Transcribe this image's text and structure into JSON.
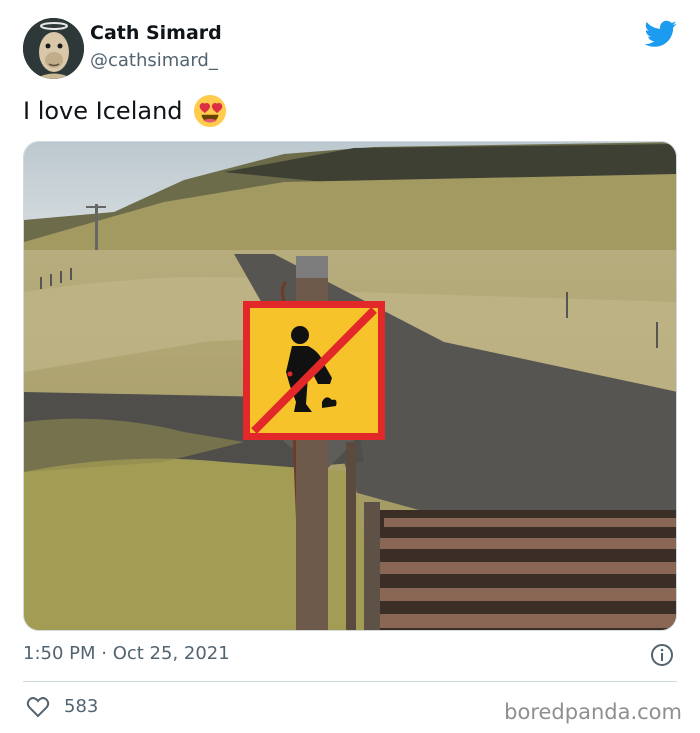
{
  "author": {
    "display_name": "Cath Simard",
    "handle": "@cathsimard_"
  },
  "tweet": {
    "text": "I love Iceland",
    "emoji_icon": "heart-eyes-emoji-icon",
    "timestamp": "1:50 PM · Oct 25, 2021",
    "likes": "583"
  },
  "photo": {
    "sign_icon": "no-defecation-sign-icon"
  },
  "watermark": "boredpanda.com",
  "colors": {
    "twitter_blue": "#1d9bf0",
    "text_primary": "#0f1419",
    "text_secondary": "#536471",
    "sign_yellow": "#f6c42a",
    "sign_red": "#e3282a"
  }
}
